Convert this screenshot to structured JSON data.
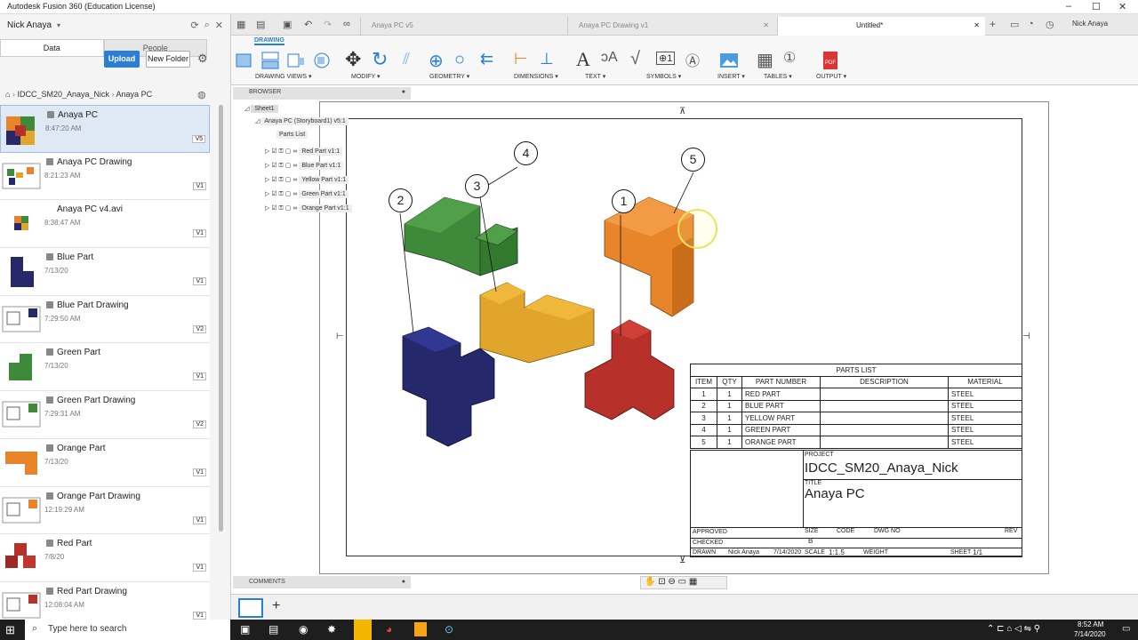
{
  "window": {
    "title": "Autodesk Fusion 360 (Education License)"
  },
  "datapanel": {
    "user": "Nick Anaya",
    "tabs": [
      "Data",
      "People"
    ],
    "upload_label": "Upload",
    "new_folder_label": "New Folder",
    "breadcrumb": [
      "IDCC_SM20_Anaya_Nick",
      "Anaya PC"
    ],
    "files": [
      {
        "name": "Anaya PC",
        "date": "8:47:20 AM",
        "version": "V5"
      },
      {
        "name": "Anaya PC Drawing",
        "date": "8:21:23 AM",
        "version": "V1"
      },
      {
        "name": "Anaya PC v4.avi",
        "date": "8:38:47 AM",
        "version": "V1"
      },
      {
        "name": "Blue Part",
        "date": "7/13/20",
        "version": "V1"
      },
      {
        "name": "Blue Part Drawing",
        "date": "7:29:50 AM",
        "version": "V2"
      },
      {
        "name": "Green Part",
        "date": "7/13/20",
        "version": "V1"
      },
      {
        "name": "Green Part Drawing",
        "date": "7:29:31 AM",
        "version": "V2"
      },
      {
        "name": "Orange Part",
        "date": "7/13/20",
        "version": "V1"
      },
      {
        "name": "Orange Part Drawing",
        "date": "12:19:29 AM",
        "version": "V1"
      },
      {
        "name": "Red Part",
        "date": "7/8/20",
        "version": "V1"
      },
      {
        "name": "Red Part Drawing",
        "date": "12:08:04 AM",
        "version": "V1"
      }
    ]
  },
  "doctabs": [
    "Anaya PC v5",
    "Anaya PC Drawing v1",
    "Untitled*"
  ],
  "ribbon": {
    "tab": "DRAWING",
    "groups": [
      "DRAWING VIEWS ▾",
      "MODIFY ▾",
      "GEOMETRY ▾",
      "DIMENSIONS ▾",
      "TEXT ▾",
      "SYMBOLS ▾",
      "INSERT ▾",
      "TABLES ▾",
      "OUTPUT ▾"
    ]
  },
  "browser": {
    "label": "BROWSER",
    "sheet": "Sheet1",
    "view": "Anaya PC (Storyboard1) v5:1",
    "parts_list": "Parts List",
    "parts": [
      "Red Part v1:1",
      "Blue Part v1:1",
      "Yellow Part v1:1",
      "Green Part v1:1",
      "Orange Part v1:1"
    ]
  },
  "comments_label": "COMMENTS",
  "balloons": [
    "1",
    "2",
    "3",
    "4",
    "5"
  ],
  "parts_list": {
    "title": "PARTS LIST",
    "headers": [
      "ITEM",
      "QTY",
      "PART NUMBER",
      "DESCRIPTION",
      "MATERIAL"
    ],
    "rows": [
      [
        "1",
        "1",
        "RED PART",
        "",
        "STEEL"
      ],
      [
        "2",
        "1",
        "BLUE PART",
        "",
        "STEEL"
      ],
      [
        "3",
        "1",
        "YELLOW PART",
        "",
        "STEEL"
      ],
      [
        "4",
        "1",
        "GREEN PART",
        "",
        "STEEL"
      ],
      [
        "5",
        "1",
        "ORANGE PART",
        "",
        "STEEL"
      ]
    ]
  },
  "title_block": {
    "project_label": "PROJECT",
    "project": "IDCC_SM20_Anaya_Nick",
    "title_label": "TITLE",
    "title": "Anaya PC",
    "approved": "APPROVED",
    "checked": "CHECKED",
    "drawn_label": "DRAWN",
    "drawn_by": "Nick Anaya",
    "drawn_date": "7/14/2020",
    "size_label": "SIZE",
    "size": "B",
    "code_label": "CODE",
    "dwg_label": "DWG NO",
    "rev_label": "REV",
    "scale_label": "SCALE",
    "scale": "1:1.5",
    "weight_label": "WEIGHT",
    "sheet_label": "SHEET",
    "sheet": "1/1"
  },
  "taskbar": {
    "search": "Type here to search",
    "time": "8:52 AM",
    "date": "7/14/2020"
  },
  "colors": {
    "green": "#3f8a3a",
    "orange": "#e8842a",
    "yellow": "#e0a52a",
    "blue": "#25286a",
    "red": "#b8302a",
    "accent": "#2a7fd4"
  }
}
